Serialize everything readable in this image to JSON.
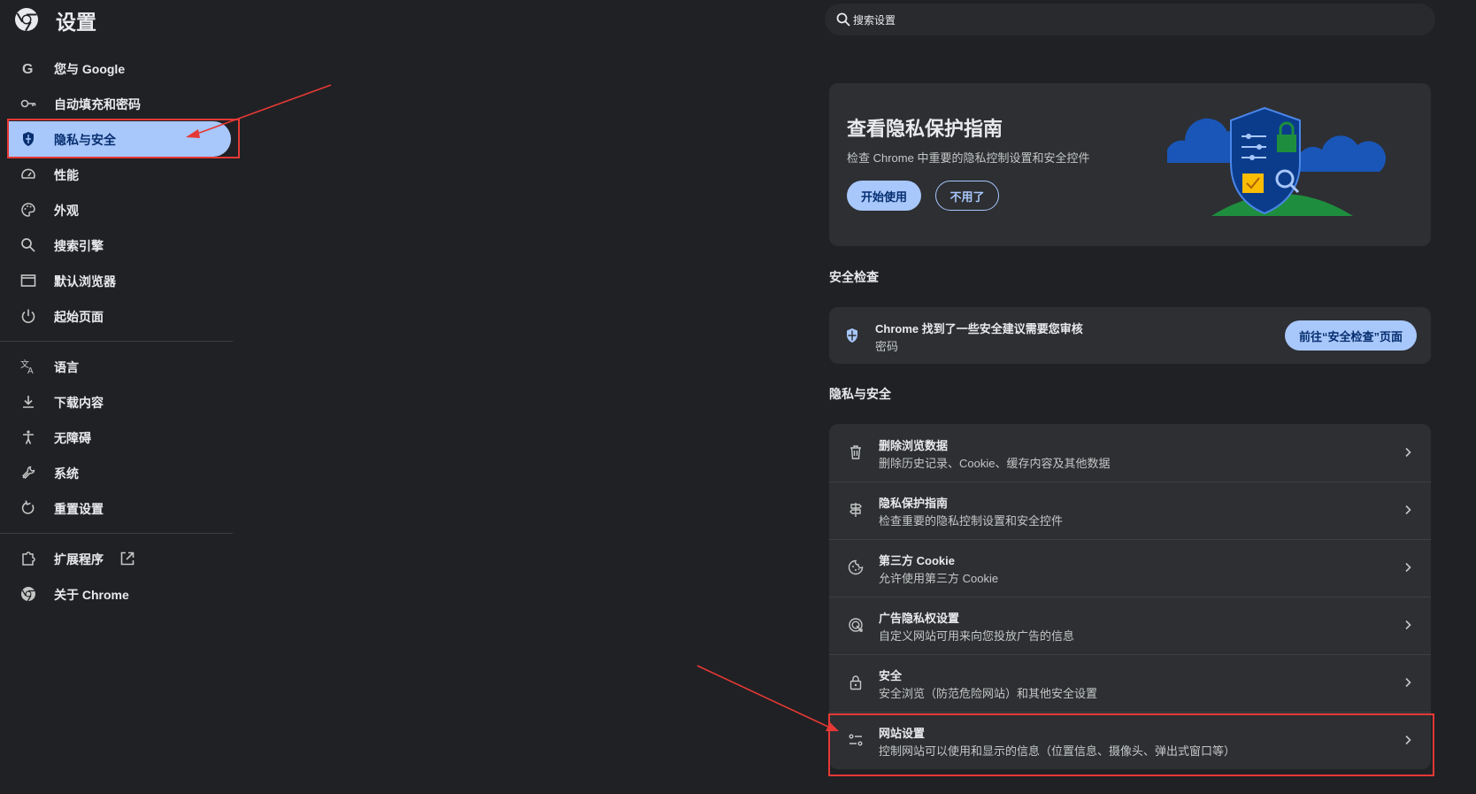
{
  "header": {
    "title": "设置",
    "search_placeholder": "搜索设置"
  },
  "sidebar": {
    "items": [
      {
        "label": "您与 Google",
        "icon": "google-icon"
      },
      {
        "label": "自动填充和密码",
        "icon": "key-icon"
      },
      {
        "label": "隐私与安全",
        "icon": "shield-icon",
        "active": true
      },
      {
        "label": "性能",
        "icon": "speedometer-icon"
      },
      {
        "label": "外观",
        "icon": "palette-icon"
      },
      {
        "label": "搜索引擎",
        "icon": "search-icon"
      },
      {
        "label": "默认浏览器",
        "icon": "browser-window-icon"
      },
      {
        "label": "起始页面",
        "icon": "power-icon"
      },
      {
        "label": "语言",
        "icon": "translate-icon"
      },
      {
        "label": "下载内容",
        "icon": "download-icon"
      },
      {
        "label": "无障碍",
        "icon": "accessibility-icon"
      },
      {
        "label": "系统",
        "icon": "wrench-icon"
      },
      {
        "label": "重置设置",
        "icon": "reset-icon"
      },
      {
        "label": "扩展程序",
        "icon": "puzzle-icon"
      },
      {
        "label": "关于 Chrome",
        "icon": "chrome-icon"
      }
    ]
  },
  "promo": {
    "title": "查看隐私保护指南",
    "description": "检查 Chrome 中重要的隐私控制设置和安全控件",
    "start_button": "开始使用",
    "dismiss_button": "不用了"
  },
  "safety_check": {
    "heading": "安全检查",
    "title": "Chrome 找到了一些安全建议需要您审核",
    "subtitle": "密码",
    "button": "前往“安全检查”页面"
  },
  "privacy": {
    "heading": "隐私与安全",
    "rows": [
      {
        "title": "删除浏览数据",
        "subtitle": "删除历史记录、Cookie、缓存内容及其他数据",
        "icon": "trash-icon"
      },
      {
        "title": "隐私保护指南",
        "subtitle": "检查重要的隐私控制设置和安全控件",
        "icon": "signpost-icon"
      },
      {
        "title": "第三方 Cookie",
        "subtitle": "允许使用第三方 Cookie",
        "icon": "cookie-icon"
      },
      {
        "title": "广告隐私权设置",
        "subtitle": "自定义网站可用来向您投放广告的信息",
        "icon": "ad-privacy-icon"
      },
      {
        "title": "安全",
        "subtitle": "安全浏览（防范危险网站）和其他安全设置",
        "icon": "lock-icon"
      },
      {
        "title": "网站设置",
        "subtitle": "控制网站可以使用和显示的信息（位置信息、摄像头、弹出式窗口等）",
        "icon": "site-settings-icon"
      }
    ]
  },
  "colors": {
    "background": "#202124",
    "card": "#2d2f33",
    "accent": "#a8c7fa",
    "annotation": "#e53935"
  }
}
